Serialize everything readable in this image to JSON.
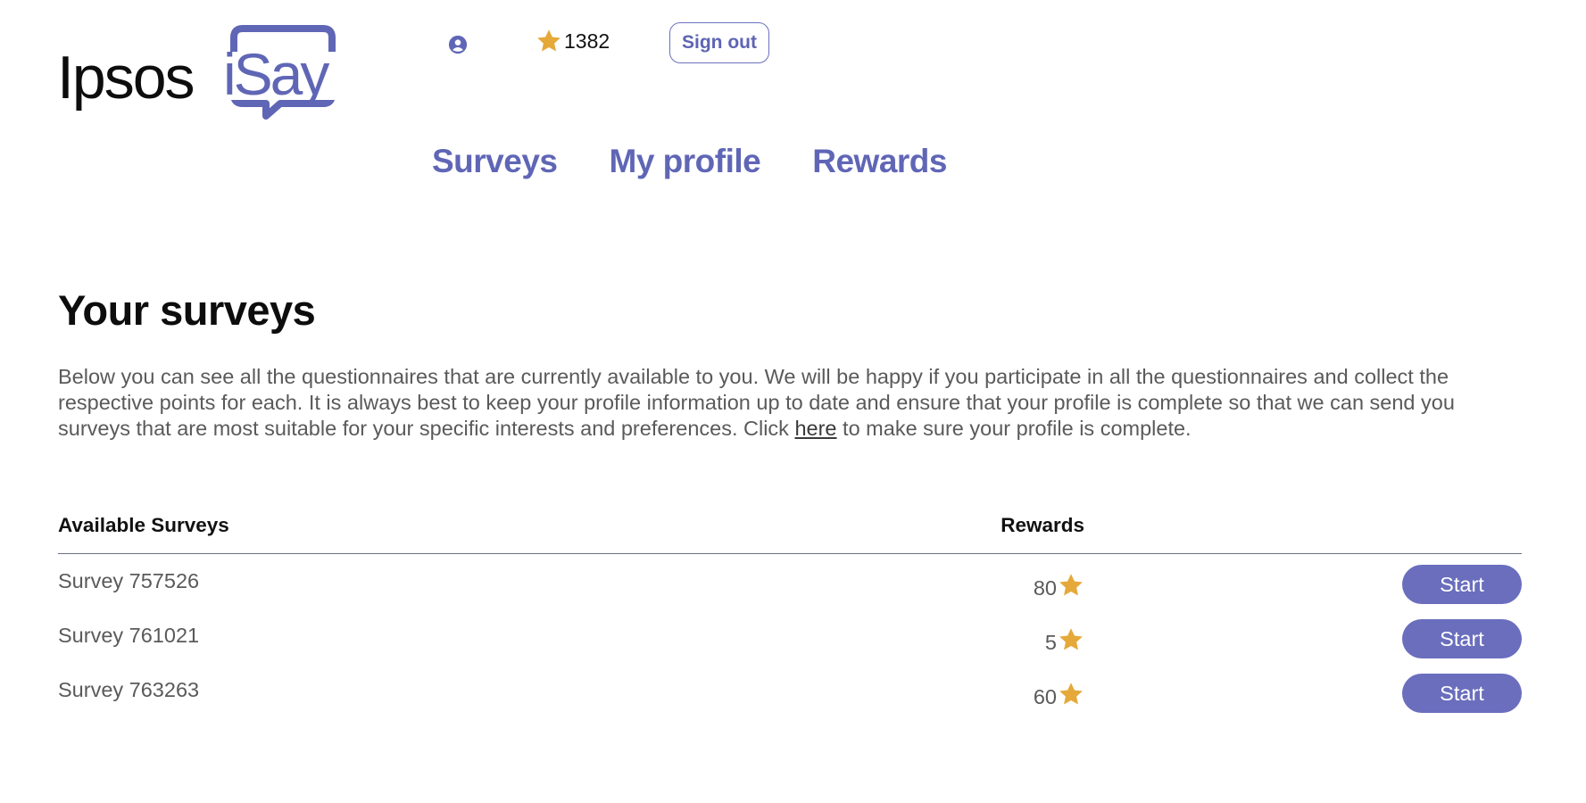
{
  "header": {
    "logo": {
      "word": "Ipsos",
      "brand": "iSay"
    },
    "points": "1382",
    "sign_out_label": "Sign out"
  },
  "nav": {
    "surveys": "Surveys",
    "my_profile": "My profile",
    "rewards": "Rewards"
  },
  "main": {
    "title": "Your surveys",
    "intro_before_link": "Below you can see all the questionnaires that are currently available to you. We will be happy if you participate in all the questionnaires and collect the respective points for each. It is always best to keep your profile information up to date and ensure that your profile is complete so that we can send you surveys that are most suitable for your specific interests and preferences. Click ",
    "intro_link": "here",
    "intro_after_link": " to make sure your profile is complete."
  },
  "table": {
    "headers": {
      "surveys": "Available Surveys",
      "rewards": "Rewards"
    },
    "rows": [
      {
        "name": "Survey 757526",
        "reward": "80",
        "action": "Start"
      },
      {
        "name": "Survey 761021",
        "reward": "5",
        "action": "Start"
      },
      {
        "name": "Survey 763263",
        "reward": "60",
        "action": "Start"
      }
    ]
  },
  "icons": {
    "profile": "user-circle-icon",
    "star": "star-icon"
  },
  "colors": {
    "brand": "#6066b6",
    "button": "#6a6ebd",
    "star": "#e5a93a"
  }
}
